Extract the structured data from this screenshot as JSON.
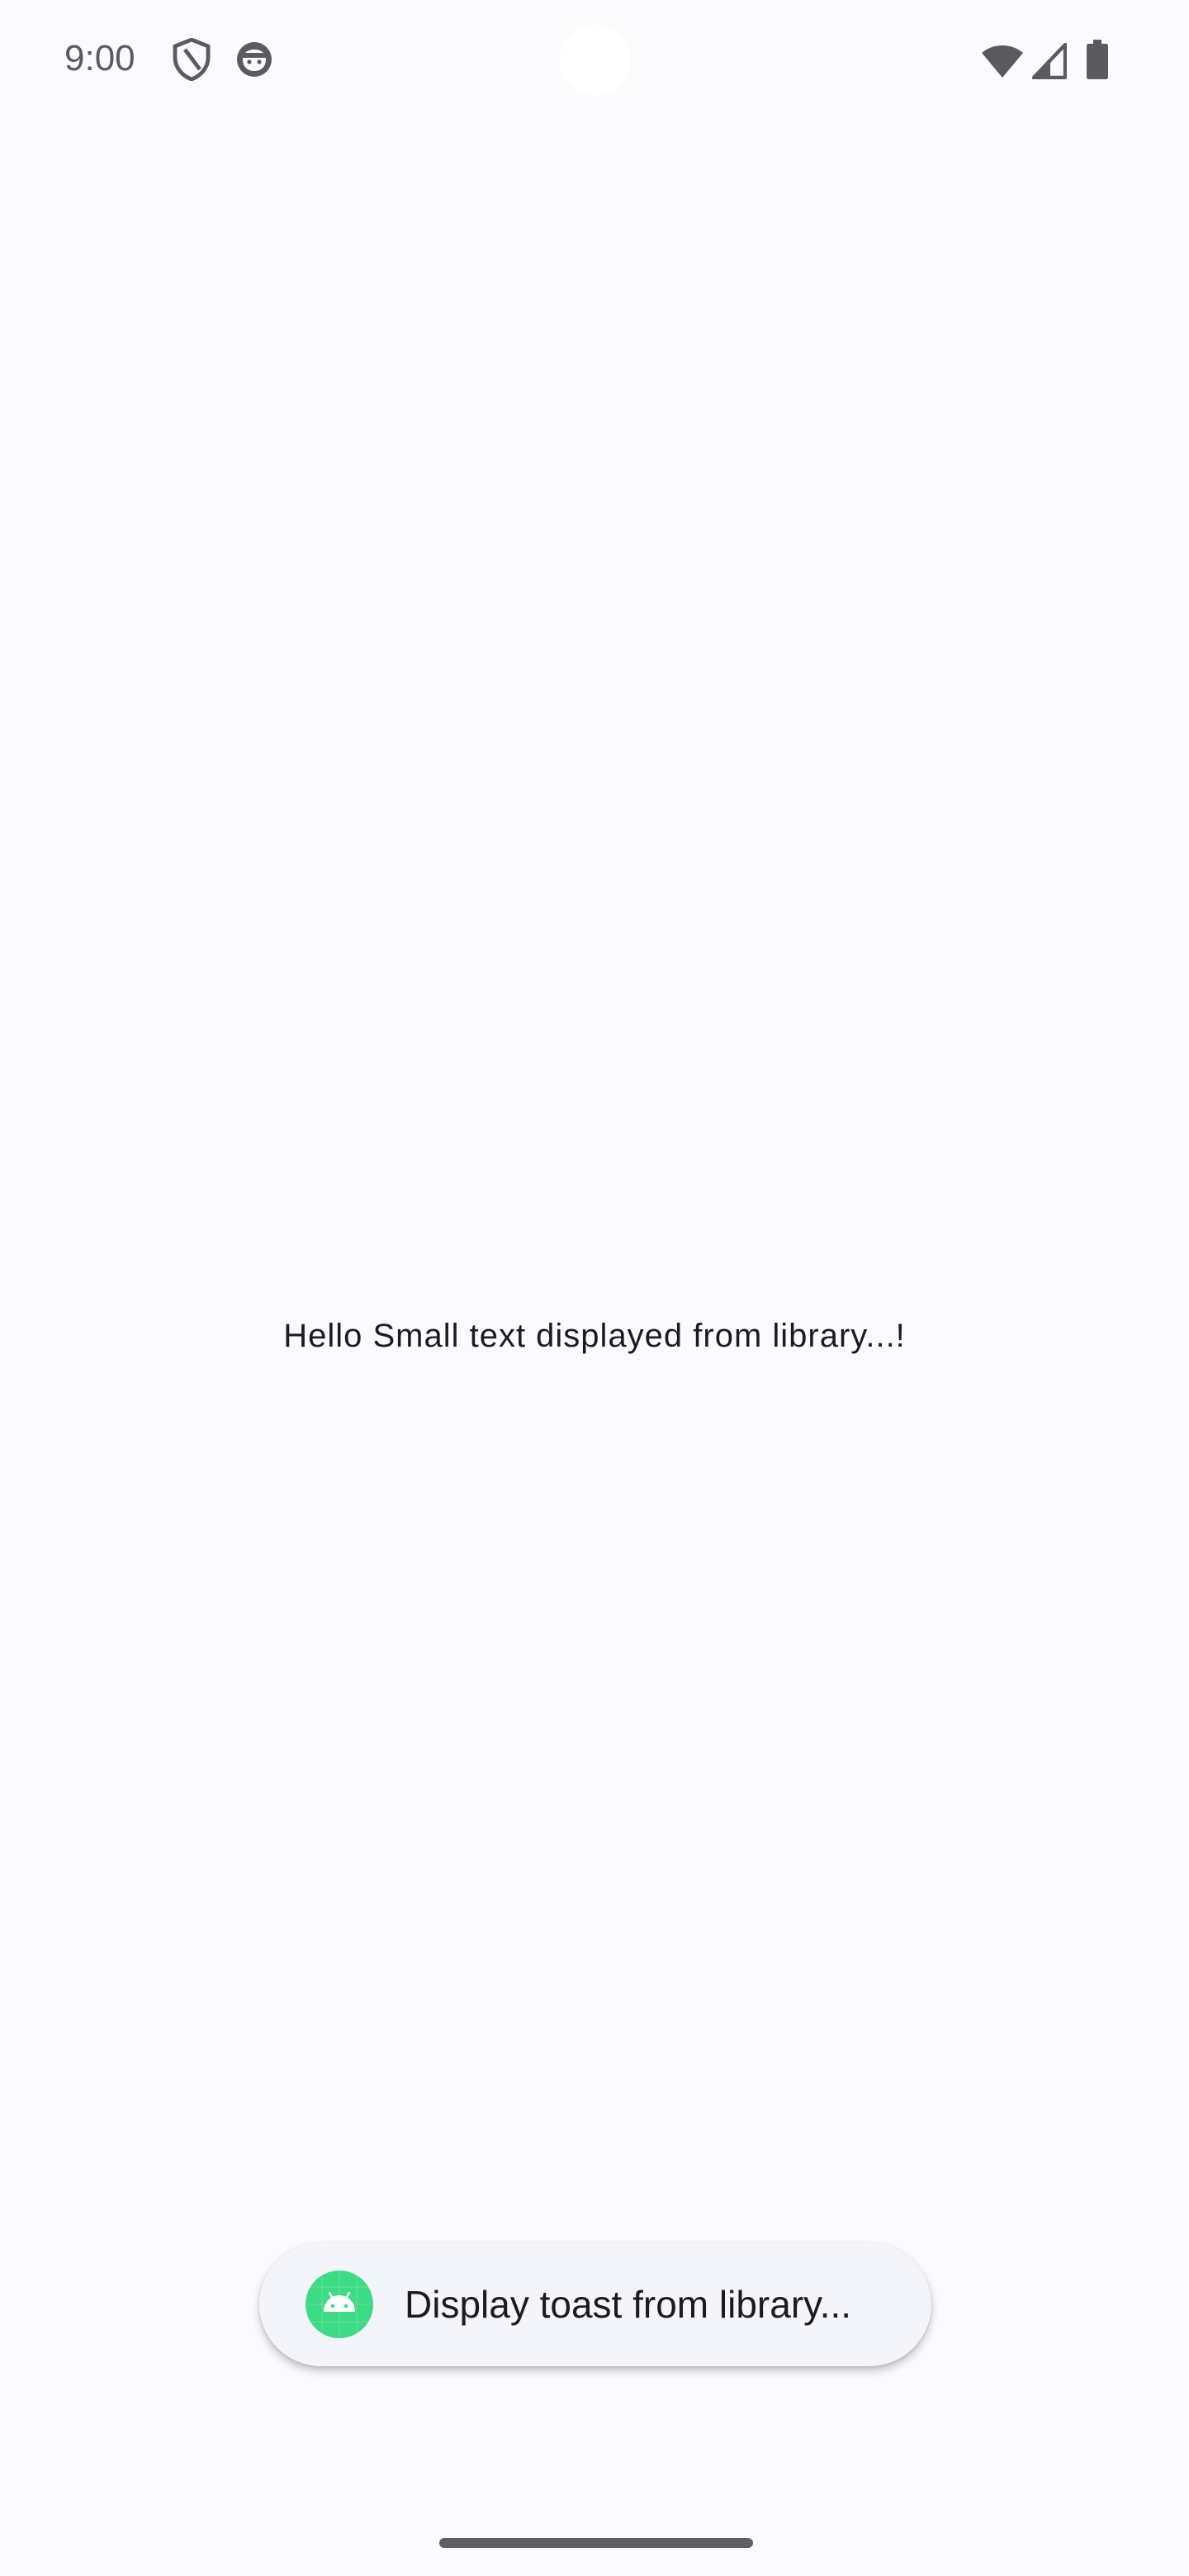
{
  "status_bar": {
    "time": "9:00",
    "icons": [
      "shield-icon",
      "face-icon",
      "wifi-icon",
      "signal-icon",
      "battery-icon"
    ]
  },
  "main": {
    "center_text": "Hello Small text displayed from library...!"
  },
  "toast": {
    "icon": "android-icon",
    "text": "Display toast from library...",
    "icon_color": "#3ddc84"
  },
  "colors": {
    "background": "#fbfbfe",
    "text": "#1c1c20",
    "status_text": "#5a5a5f"
  }
}
